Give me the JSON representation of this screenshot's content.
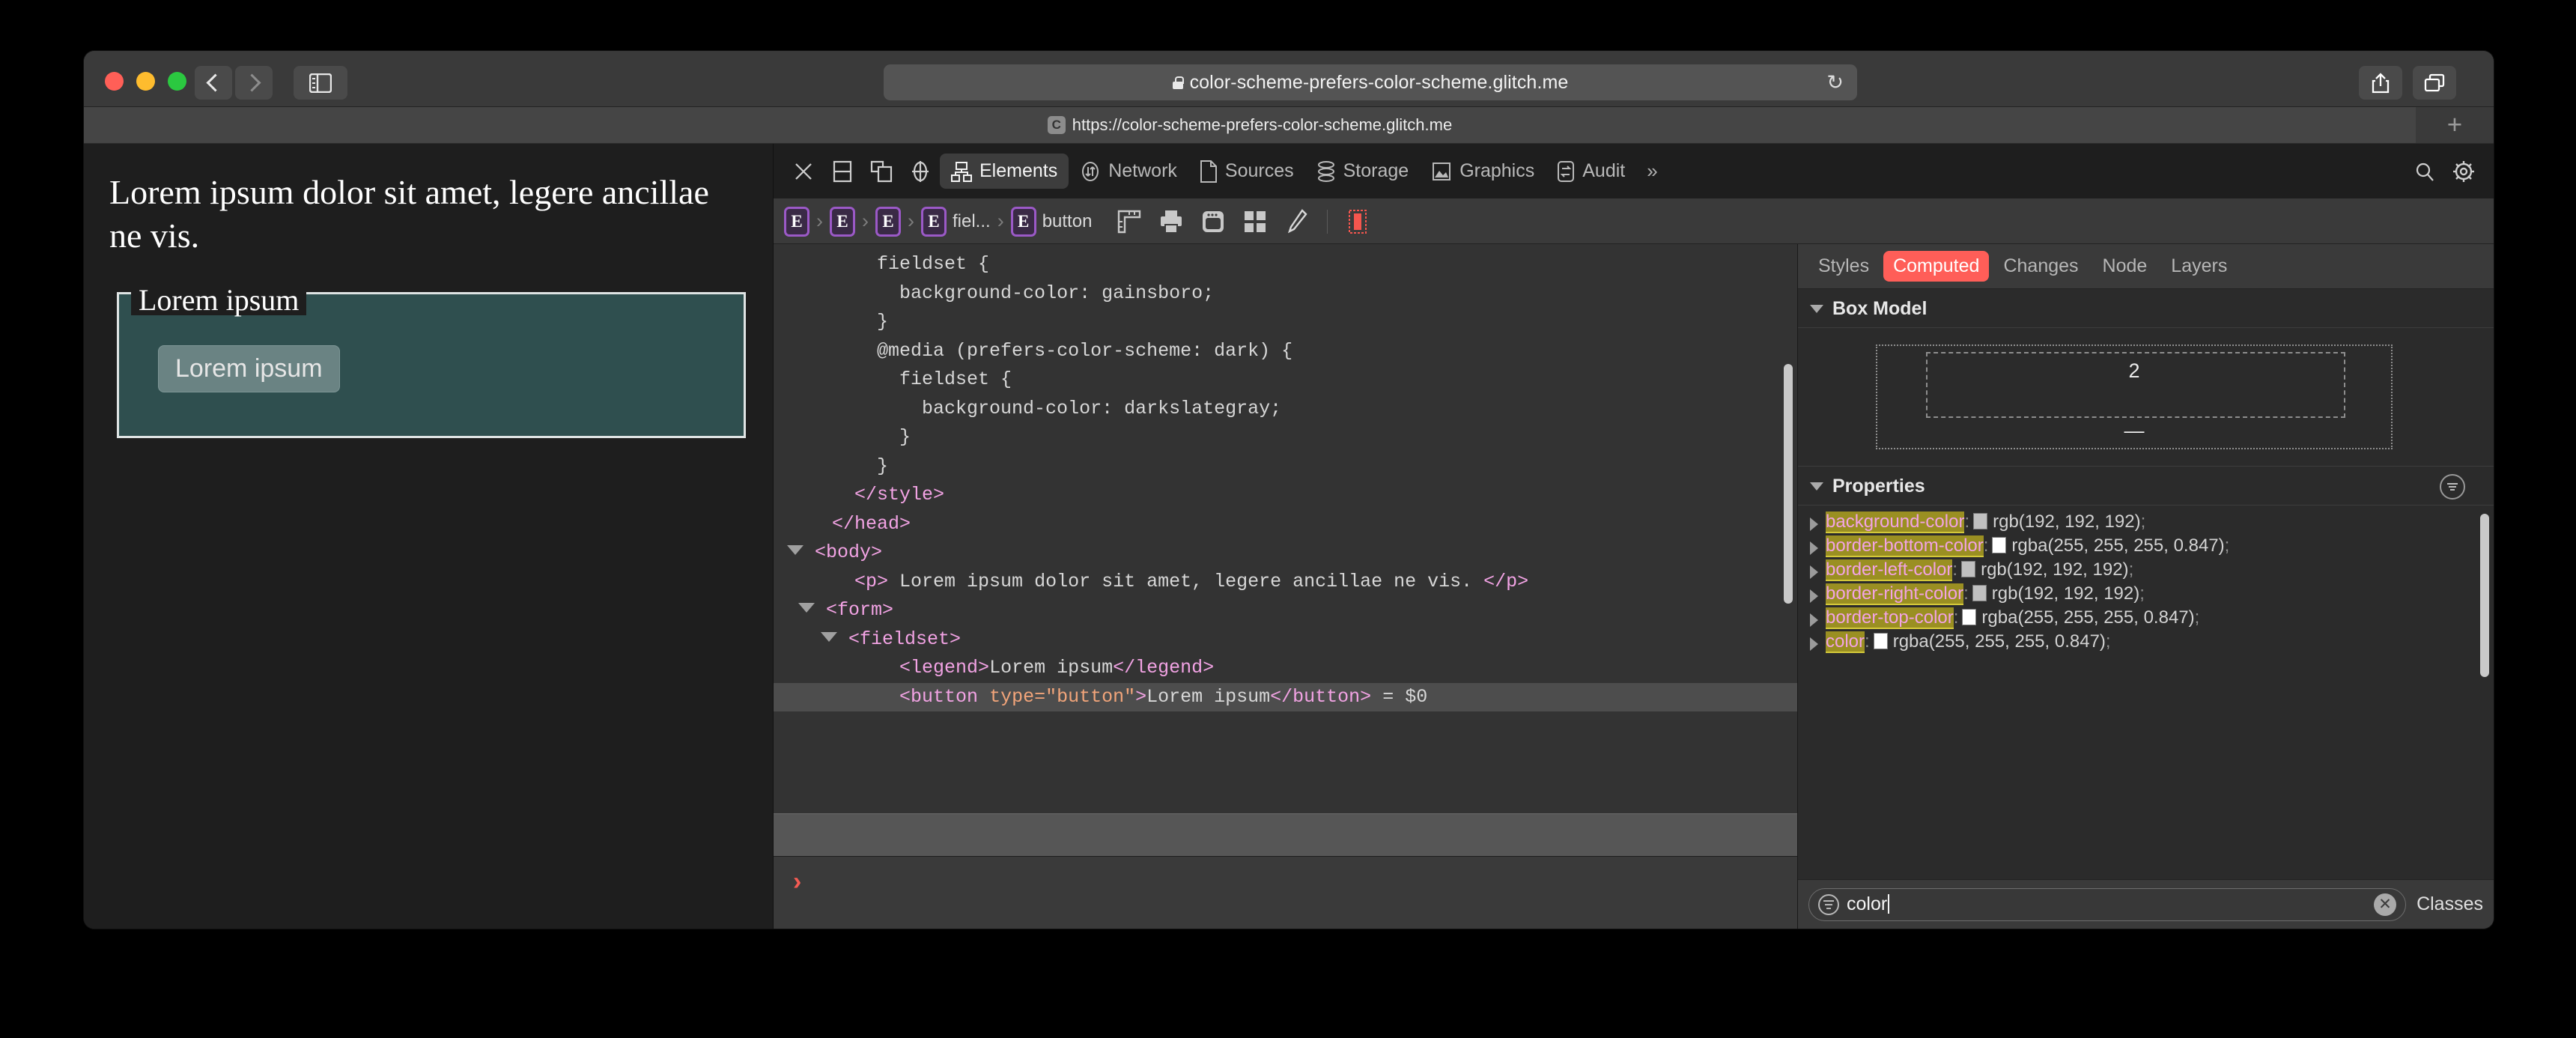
{
  "browser": {
    "url_display": "color-scheme-prefers-color-scheme.glitch.me",
    "tab_url": "https://color-scheme-prefers-color-scheme.glitch.me",
    "favicon_letter": "C",
    "reload_glyph": "↻",
    "new_tab_glyph": "+",
    "back_label": "Back",
    "forward_label": "Forward"
  },
  "page": {
    "paragraph": "Lorem ipsum dolor sit amet, legere ancillae ne vis.",
    "legend": "Lorem ipsum",
    "button_label": "Lorem ipsum",
    "fieldset_bg": "#2f4f4f",
    "button_bg": "#6a8383"
  },
  "devtools": {
    "tabs": [
      {
        "label": "Elements",
        "active": true
      },
      {
        "label": "Network",
        "active": false
      },
      {
        "label": "Sources",
        "active": false
      },
      {
        "label": "Storage",
        "active": false
      },
      {
        "label": "Graphics",
        "active": false
      },
      {
        "label": "Audit",
        "active": false
      }
    ],
    "more_glyph": "»",
    "breadcrumb": [
      {
        "badge": "E",
        "label": ""
      },
      {
        "badge": "E",
        "label": ""
      },
      {
        "badge": "E",
        "label": ""
      },
      {
        "badge": "E",
        "label": "fiel..."
      },
      {
        "badge": "E",
        "label": "button"
      }
    ],
    "breadcrumb_sep": "›",
    "dom_lines": [
      {
        "indent": 4,
        "parts": [
          {
            "t": "txt",
            "v": "fieldset {"
          }
        ]
      },
      {
        "indent": 5,
        "parts": [
          {
            "t": "txt",
            "v": "background-color: gainsboro;"
          }
        ]
      },
      {
        "indent": 4,
        "parts": [
          {
            "t": "txt",
            "v": "}"
          }
        ]
      },
      {
        "indent": 4,
        "parts": [
          {
            "t": "txt",
            "v": "@media (prefers-color-scheme: dark) {"
          }
        ]
      },
      {
        "indent": 5,
        "parts": [
          {
            "t": "txt",
            "v": "fieldset {"
          }
        ]
      },
      {
        "indent": 6,
        "parts": [
          {
            "t": "txt",
            "v": "background-color: darkslategray;"
          }
        ]
      },
      {
        "indent": 5,
        "parts": [
          {
            "t": "txt",
            "v": "}"
          }
        ]
      },
      {
        "indent": 4,
        "parts": [
          {
            "t": "txt",
            "v": "}"
          }
        ]
      },
      {
        "indent": 3,
        "parts": [
          {
            "t": "tag",
            "v": "</style>"
          }
        ]
      },
      {
        "indent": 2,
        "parts": [
          {
            "t": "tag",
            "v": "</head>"
          }
        ]
      },
      {
        "indent": 1,
        "triangle": "down",
        "parts": [
          {
            "t": "tag",
            "v": "<body>"
          }
        ]
      },
      {
        "indent": 3,
        "parts": [
          {
            "t": "tag",
            "v": "<p>"
          },
          {
            "t": "txt",
            "v": " Lorem ipsum dolor sit amet, legere ancillae ne vis. "
          },
          {
            "t": "tag",
            "v": "</p>"
          }
        ]
      },
      {
        "indent": 2,
        "triangle": "down",
        "parts": [
          {
            "t": "tag",
            "v": "<form>"
          }
        ]
      },
      {
        "indent": 3,
        "triangle": "down",
        "parts": [
          {
            "t": "tag",
            "v": "<fieldset>"
          }
        ]
      },
      {
        "indent": 5,
        "parts": [
          {
            "t": "tag",
            "v": "<legend>"
          },
          {
            "t": "txt",
            "v": "Lorem ipsum"
          },
          {
            "t": "tag",
            "v": "</legend>"
          }
        ]
      },
      {
        "indent": 5,
        "selected": true,
        "parts": [
          {
            "t": "tag",
            "v": "<button "
          },
          {
            "t": "attr",
            "v": "type=\"button\""
          },
          {
            "t": "tag",
            "v": ">"
          },
          {
            "t": "txt",
            "v": "Lorem ipsum"
          },
          {
            "t": "tag",
            "v": "</button>"
          },
          {
            "t": "txt",
            "v": " = $0"
          }
        ]
      }
    ],
    "console_prompt": "›"
  },
  "styles": {
    "tabs": [
      {
        "label": "Styles",
        "active": false
      },
      {
        "label": "Computed",
        "active": true
      },
      {
        "label": "Changes",
        "active": false
      },
      {
        "label": "Node",
        "active": false
      },
      {
        "label": "Layers",
        "active": false
      }
    ],
    "box_model": {
      "title": "Box Model",
      "top_value": "2",
      "bottom_value": "—"
    },
    "properties_title": "Properties",
    "properties": [
      {
        "name": "background-color",
        "swatch": "#c0c0c0",
        "value": "rgb(192, 192, 192)",
        "highlight": true
      },
      {
        "name": "border-bottom-color",
        "swatch": "#ffffff",
        "value": "rgba(255, 255, 255, 0.847)",
        "highlight": true
      },
      {
        "name": "border-left-color",
        "swatch": "#c0c0c0",
        "value": "rgb(192, 192, 192)",
        "highlight": true
      },
      {
        "name": "border-right-color",
        "swatch": "#c0c0c0",
        "value": "rgb(192, 192, 192)",
        "highlight": true
      },
      {
        "name": "border-top-color",
        "swatch": "#ffffff",
        "value": "rgba(255, 255, 255, 0.847)",
        "highlight": true
      },
      {
        "name": "color",
        "swatch": "#ffffff",
        "value": "rgba(255, 255, 255, 0.847)",
        "highlight": true
      }
    ],
    "filter_value": "color",
    "filter_placeholder": "Filter",
    "clear_glyph": "✕",
    "classes_label": "Classes"
  }
}
